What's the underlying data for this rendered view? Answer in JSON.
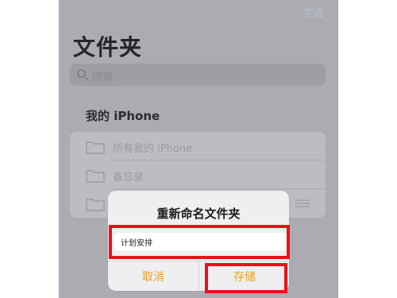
{
  "header": {
    "done_label": "完成",
    "title": "文件夹"
  },
  "search": {
    "placeholder": "搜索"
  },
  "section": {
    "title": "我的 iPhone"
  },
  "folders": [
    {
      "label": "所有我的 iPhone"
    },
    {
      "label": "备忘录"
    },
    {
      "label": ""
    }
  ],
  "dialog": {
    "title": "重新命名文件夹",
    "input_value": "计划安排",
    "cancel_label": "取消",
    "save_label": "存储"
  },
  "colors": {
    "accent": "#f2a01c",
    "highlight": "#e8121a",
    "dimmed_background": "#ababb1"
  }
}
